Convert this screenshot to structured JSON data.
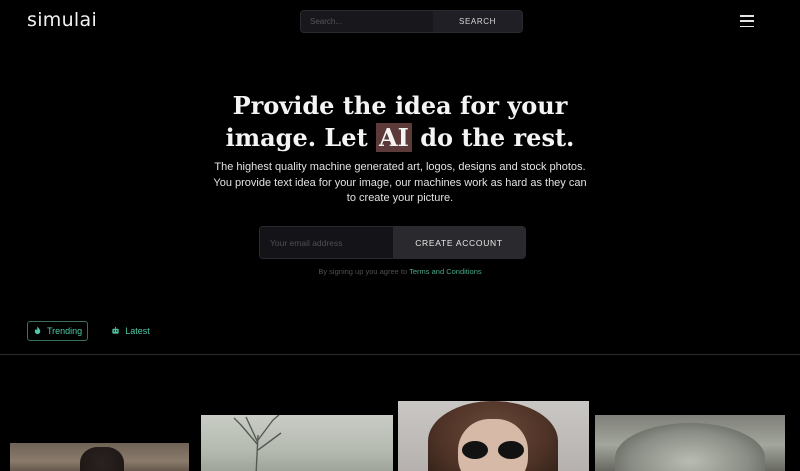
{
  "header": {
    "logo": "simulai",
    "search_placeholder": "Search...",
    "search_button": "SEARCH"
  },
  "hero": {
    "title_line1": "Provide the idea for your",
    "title_line2_pre": "image. Let ",
    "title_highlight": "AI",
    "title_line2_post": " do the rest.",
    "description": "The highest quality machine generated art, logos, designs and stock photos. You provide text idea for your image, our machines work as hard as they can to create your picture.",
    "email_placeholder": "Your email address",
    "create_account_button": "CREATE ACCOUNT",
    "terms_prefix": "By signing up you agree to ",
    "terms_link": "Terms and Conditions"
  },
  "tabs": [
    {
      "label": "Trending",
      "icon": "fire-icon",
      "active": true
    },
    {
      "label": "Latest",
      "icon": "robot-icon",
      "active": false
    }
  ],
  "colors": {
    "accent": "#4fc8a8",
    "background": "#000000",
    "highlight": "#5c3a3a"
  }
}
